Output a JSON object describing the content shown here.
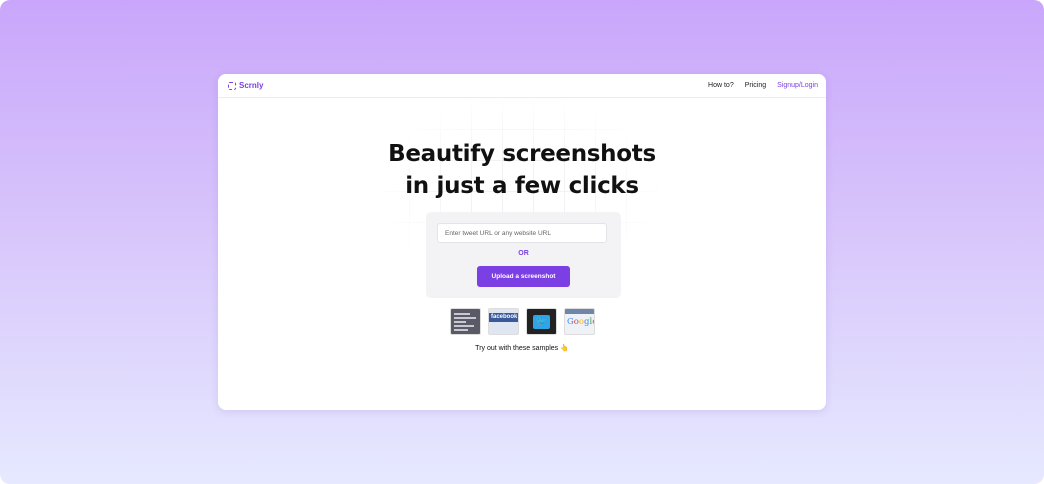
{
  "app": {
    "name": "Scrnly"
  },
  "nav": {
    "how_to": "How to?",
    "pricing": "Pricing",
    "signup": "Signup/Login"
  },
  "hero": {
    "line1": "Beautify screenshots",
    "line2": "in just a few clicks"
  },
  "form": {
    "url_placeholder": "Enter tweet URL or any website URL",
    "or_label": "OR",
    "upload_label": "Upload a screenshot"
  },
  "samples": {
    "items": [
      {
        "icon": "code-editor-sample-icon"
      },
      {
        "icon": "facebook-sample-icon",
        "text": "facebook"
      },
      {
        "icon": "twitter-sample-icon"
      },
      {
        "icon": "google-sample-icon"
      }
    ],
    "caption": "Try out with these samples 👆"
  },
  "colors": {
    "accent": "#7b3fe4",
    "background_top": "#c9a6fb",
    "background_bottom": "#e6e9ff"
  }
}
